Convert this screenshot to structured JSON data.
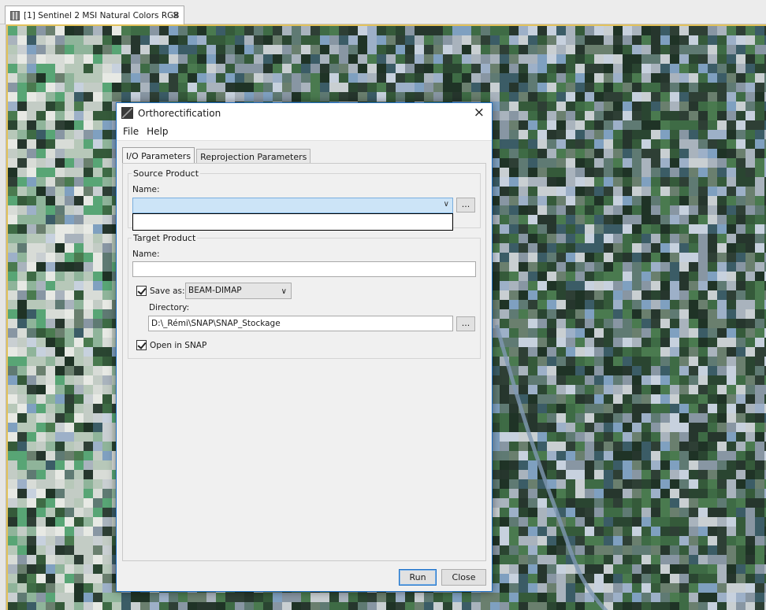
{
  "doc_tab": {
    "title": "[1] Sentinel 2 MSI Natural Colors RGB",
    "close": "×",
    "icon": "raster-image-icon"
  },
  "dialog": {
    "title": "Orthorectification",
    "close": "×",
    "icon": "snap-app-icon",
    "menu": {
      "file": "File",
      "help": "Help"
    },
    "tabs": {
      "io": "I/O Parameters",
      "reprojection": "Reprojection Parameters"
    },
    "source": {
      "title": "Source Product",
      "name_label": "Name:",
      "selected_value": "",
      "browse": "..."
    },
    "target": {
      "title": "Target Product",
      "name_label": "Name:",
      "name_value": "",
      "save_as_label": "Save as:",
      "save_as_checked": true,
      "format": "BEAM-DIMAP",
      "directory_label": "Directory:",
      "directory_value": "D:\\_Rémi\\SNAP\\SNAP_Stockage",
      "browse": "...",
      "open_in_snap_label": "Open in SNAP",
      "open_in_snap_checked": true
    },
    "buttons": {
      "run": "Run",
      "close": "Close"
    }
  },
  "colors": {
    "accent": "#1e6fc1",
    "view_border": "#e3c25a",
    "combo_highlight": "#cce4f7"
  }
}
